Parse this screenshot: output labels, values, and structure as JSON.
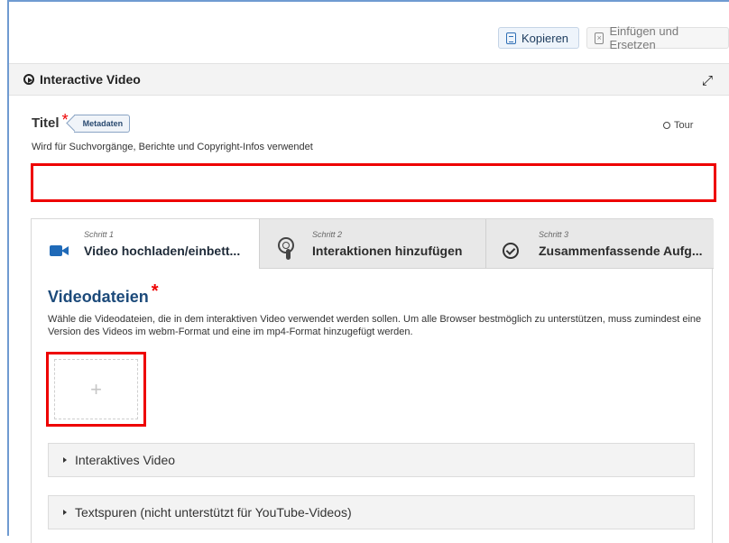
{
  "toolbar": {
    "copy_label": "Kopieren",
    "paste_label": "Einfügen und Ersetzen"
  },
  "header": {
    "title": "Interactive Video"
  },
  "title_field": {
    "label": "Titel",
    "required_mark": "*",
    "tag": "Metadaten",
    "tour_label": "Tour",
    "description": "Wird für Suchvorgänge, Berichte und Copyright-Infos verwendet",
    "value": ""
  },
  "steps": [
    {
      "number": "Schritt 1",
      "label": "Video hochladen/einbett...",
      "icon": "video-camera-icon",
      "active": true
    },
    {
      "number": "Schritt 2",
      "label": "Interaktionen hinzufügen",
      "icon": "touch-icon",
      "active": false
    },
    {
      "number": "Schritt 3",
      "label": "Zusammenfassende Aufg...",
      "icon": "check-circle-icon",
      "active": false
    }
  ],
  "video_files": {
    "title": "Videodateien",
    "required_mark": "*",
    "description": "Wähle die Videodateien, die in dem interaktiven Video verwendet werden sollen. Um alle Browser bestmöglich zu unterstützen, muss zumindest eine Version des Videos im webm-Format und eine im mp4-Format hinzugefügt werden.",
    "add_symbol": "+"
  },
  "accordions": [
    {
      "label": "Interaktives Video"
    },
    {
      "label": "Textspuren (nicht unterstützt für YouTube-Videos)"
    }
  ],
  "colors": {
    "highlight": "#ee0000",
    "accent": "#1f6ab8",
    "section_title": "#1c4a7a"
  }
}
